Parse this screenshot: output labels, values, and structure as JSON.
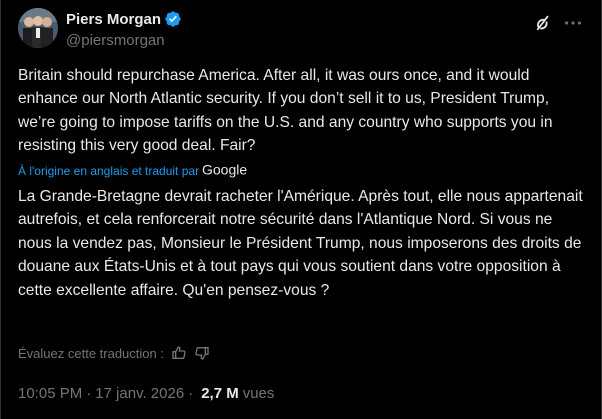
{
  "author": {
    "display_name": "Piers Morgan",
    "handle": "@piersmorgan",
    "verified_color": "#1d9bf0"
  },
  "icons": {
    "avatar": "profile-photo",
    "verified": "verified-badge-icon",
    "grok": "grok-icon",
    "more": "more-horizontal-icon",
    "thumbs_up": "thumbs-up-icon",
    "thumbs_down": "thumbs-down-icon",
    "google": "google-logo"
  },
  "tweet": {
    "text": "Britain should repurchase America. After all, it was ours once, and it would enhance our North Atlantic security. If you don’t sell it to us, President Trump, we’re going to impose tariffs on the U.S. and any country who supports you in resisting this very good deal. Fair?",
    "translation_note": "À l'origine en anglais et traduit par",
    "translation_provider": "Google",
    "translated_text": "La Grande-Bretagne devrait racheter l'Amérique. Après tout, elle nous appartenait autrefois, et cela renforcerait notre sécurité dans l'Atlantique Nord. Si vous ne nous la vendez pas, Monsieur le Président Trump, nous imposerons des droits de douane aux États-Unis et à tout pays qui vous soutient dans votre opposition à cette excellente affaire. Qu'en pensez-vous ?",
    "rate_translation": "Évaluez cette traduction :"
  },
  "meta": {
    "time": "10:05 PM",
    "separator": "·",
    "date": "17 janv. 2026",
    "views_count": "2,7 M",
    "views_label": "vues"
  },
  "colors": {
    "background": "#000000",
    "text_primary": "#e7e9ea",
    "text_secondary": "#71767b",
    "accent": "#1d9bf0"
  }
}
